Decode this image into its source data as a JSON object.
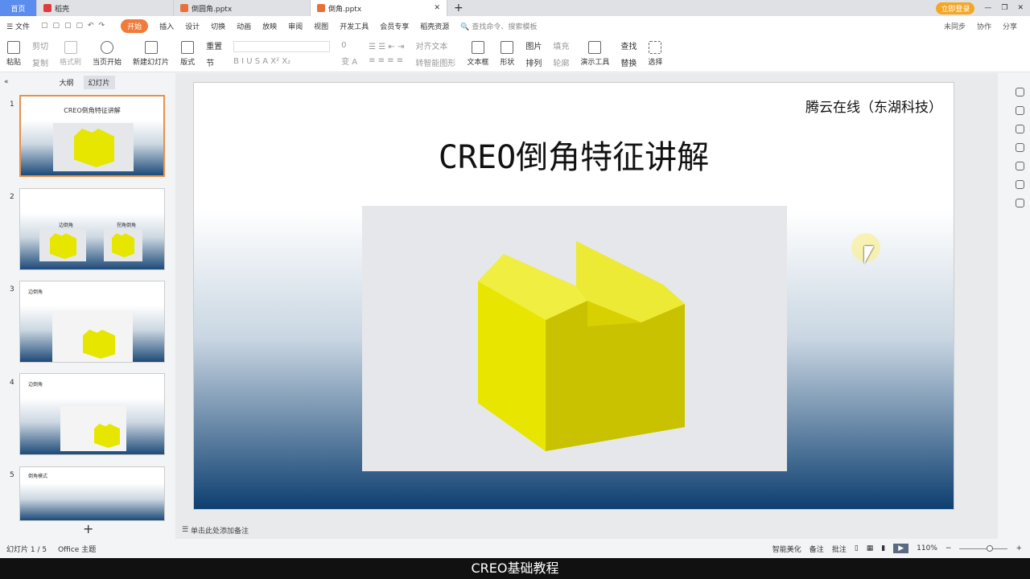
{
  "tabs": [
    {
      "label": "首页"
    },
    {
      "label": "稻壳"
    },
    {
      "label": "倒圆角.pptx"
    },
    {
      "label": "倒角.pptx"
    }
  ],
  "window": {
    "login": "立即登录"
  },
  "menu": {
    "file": "文件",
    "items": [
      "开始",
      "插入",
      "设计",
      "切换",
      "动画",
      "放映",
      "审阅",
      "视图",
      "开发工具",
      "会员专享",
      "稻壳资源"
    ],
    "search": "查找命令、搜索模板",
    "sync": "未同步",
    "collab": "协作",
    "share": "分享"
  },
  "ribbon": {
    "paste": "粘贴",
    "cut": "剪切",
    "copy": "复制",
    "format_painter": "格式刷",
    "play_from": "当页开始",
    "new_slide": "新建幻灯片",
    "layout": "版式",
    "reset": "重置",
    "section": "节",
    "font_size": "0",
    "align_text": "对齐文本",
    "smart": "转智能图形",
    "textbox": "文本框",
    "shape": "形状",
    "picture": "图片",
    "arrange": "排列",
    "fill": "填充",
    "outline": "轮廓",
    "present_tools": "演示工具",
    "find": "查找",
    "replace": "替换",
    "select": "选择"
  },
  "left": {
    "tab_outline": "大纲",
    "tab_slides": "幻灯片",
    "slides": [
      {
        "num": "1",
        "title": "CREO倒角特征讲解"
      },
      {
        "num": "2",
        "label_a": "边倒角",
        "label_b": "拐角倒角"
      },
      {
        "num": "3",
        "title": "边倒角"
      },
      {
        "num": "4",
        "title": "边倒角"
      },
      {
        "num": "5",
        "title": "倒角模式"
      }
    ],
    "add": "+"
  },
  "slide": {
    "company": "腾云在线（东湖科技）",
    "title": "CREO倒角特征讲解"
  },
  "notes": {
    "placeholder": "单击此处添加备注"
  },
  "status": {
    "slide_count": "幻灯片 1 / 5",
    "theme": "Office 主题",
    "beautify": "智能美化",
    "notes": "备注",
    "comment": "批注",
    "zoom": "110%"
  },
  "caption": "CREO基础教程",
  "colors": {
    "accent": "#f07b3a",
    "home_tab": "#5b8def"
  }
}
